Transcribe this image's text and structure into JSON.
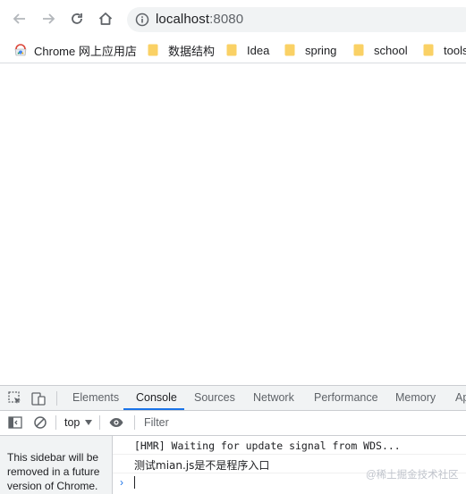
{
  "browser": {
    "url_host": "localhost",
    "url_port": ":8080"
  },
  "bookmarks": [
    {
      "label": "Chrome 网上应用店",
      "icon": "chrome-web-store-icon"
    },
    {
      "label": "数据结构",
      "icon": "folder-icon"
    },
    {
      "label": "Idea",
      "icon": "folder-icon"
    },
    {
      "label": "spring",
      "icon": "folder-icon"
    },
    {
      "label": "school",
      "icon": "folder-icon"
    },
    {
      "label": "tools",
      "icon": "folder-icon"
    }
  ],
  "devtools": {
    "tabs": [
      "Elements",
      "Console",
      "Sources",
      "Network",
      "Performance",
      "Memory",
      "Ap"
    ],
    "active_tab": "Console",
    "context": "top",
    "filter_placeholder": "Filter",
    "sidebar_note": "This sidebar will be removed in a future version of Chrome.",
    "logs": [
      "[HMR] Waiting for update signal from WDS...",
      "测试mian.js是不是程序入口"
    ],
    "prompt_symbol": "›"
  },
  "watermark": "@稀土掘金技术社区",
  "colors": {
    "accent": "#1a73e8",
    "folder": "#fad165",
    "toolbar_bg": "#f1f3f4"
  }
}
